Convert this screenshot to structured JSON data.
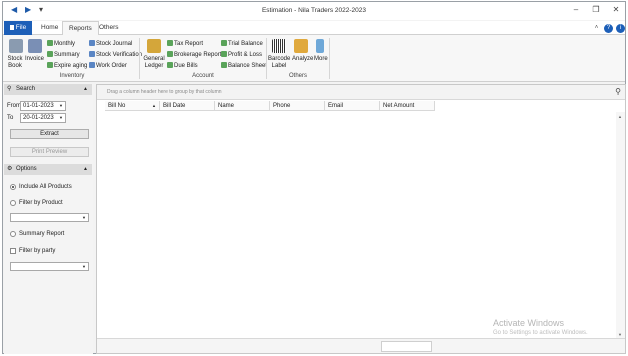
{
  "window": {
    "title": "Estimation - Nila Traders 2022-2023",
    "minimize_glyph": "–",
    "restore_glyph": "❐",
    "close_glyph": "✕"
  },
  "quick_access": {
    "back_glyph": "◀",
    "forward_glyph": "▶",
    "menu_glyph": "▾"
  },
  "tabs": [
    {
      "label": "File"
    },
    {
      "label": "Home"
    },
    {
      "label": "Reports"
    },
    {
      "label": "Others"
    }
  ],
  "ribbon_right": {
    "collapse_glyph": "˄",
    "help_glyph": "?",
    "info_glyph": "i"
  },
  "ribbon": {
    "inventory": {
      "label": "Inventory",
      "stock_book": "Stock Book",
      "invoice": "Invoice",
      "monthly": "Monthly",
      "summary": "Summary",
      "expire_aging": "Expire aging",
      "stock_journal": "Stock Journal",
      "stock_verification": "Stock Verification",
      "work_order": "Work Order"
    },
    "account": {
      "label": "Account",
      "general_ledger": "General Ledger",
      "tax_report": "Tax Report",
      "brokerage_report": "Brokerage Report",
      "due_bills": "Due Bills",
      "trial_balance": "Trial Balance",
      "profit_loss": "Profit & Loss",
      "balance_sheet": "Balance Sheet"
    },
    "others": {
      "label": "Others",
      "barcode_label": "Barcode Label",
      "analyze": "Analyze",
      "more": "More"
    }
  },
  "search_panel": {
    "header": "Search",
    "from_label": "From",
    "from_value": "01-01-2023",
    "to_label": "To",
    "to_value": "20-01-2023",
    "extract": "Extract",
    "print_preview": "Print Preview"
  },
  "options_panel": {
    "header": "Options",
    "include_all_products": "Include All Products",
    "filter_by_product": "Filter by Product",
    "summary_report": "Summary Report",
    "filter_by_party": "Filter by party"
  },
  "grid": {
    "group_hint": "Drag a column header here to group by that column",
    "columns": [
      "Bill No",
      "Bill Date",
      "Name",
      "Phone",
      "Email",
      "Net Amount"
    ]
  },
  "watermark": {
    "line1": "Activate Windows",
    "line2": "Go to Settings to activate Windows."
  },
  "colors": {
    "accent": "#1d5fb8"
  }
}
